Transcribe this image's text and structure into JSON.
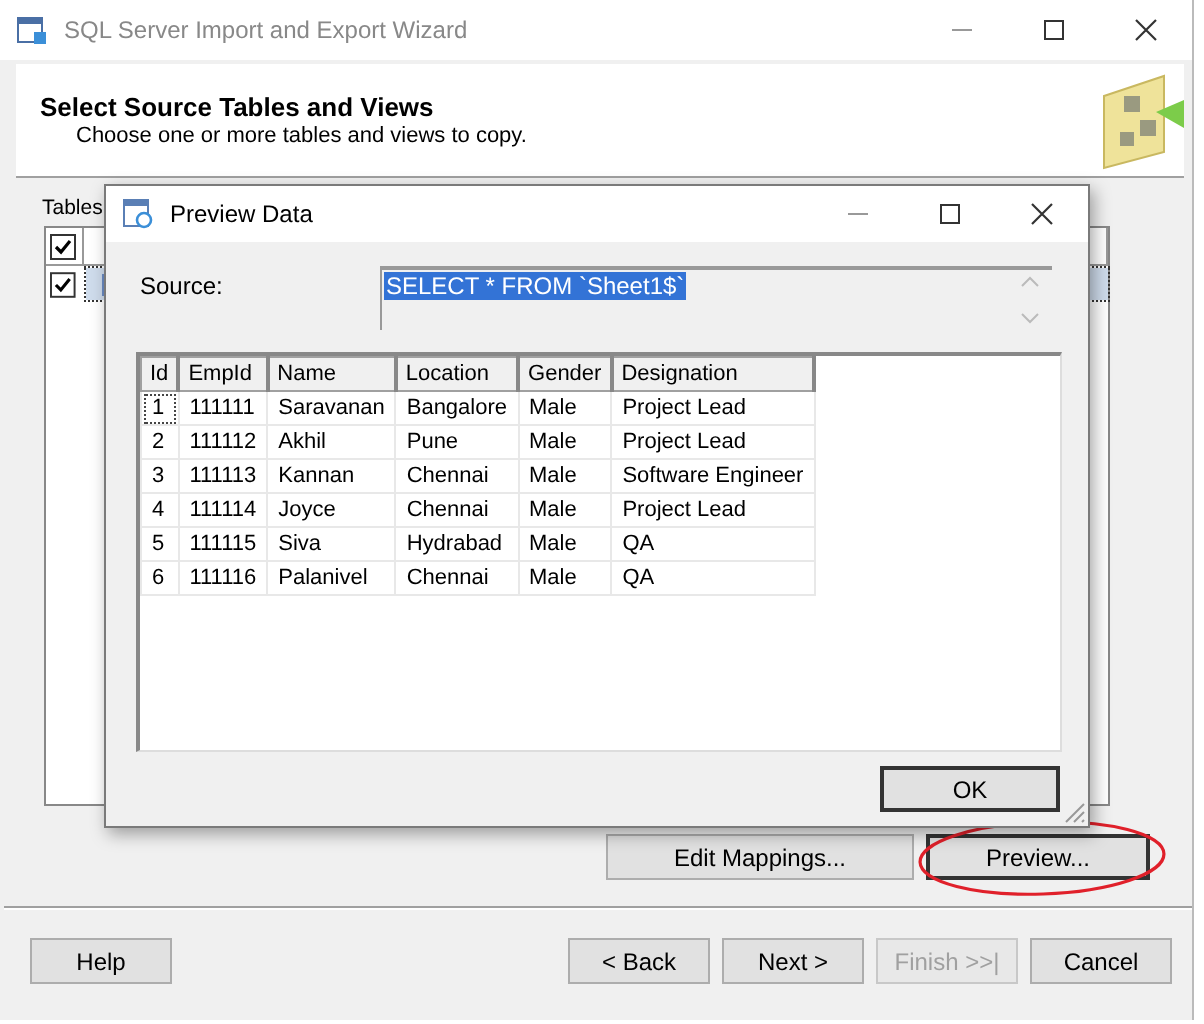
{
  "window": {
    "title": "SQL Server Import and Export Wizard"
  },
  "header": {
    "title": "Select Source Tables and Views",
    "subtitle": "Choose one or more tables and views to copy."
  },
  "tables_label": "Tables",
  "table_list": {
    "header": {
      "checked": true
    },
    "rows": [
      {
        "checked": true,
        "selected": true
      }
    ]
  },
  "preview_dialog": {
    "title": "Preview Data",
    "source_label": "Source:",
    "source_query": "SELECT * FROM `Sheet1$`",
    "query_selected": true,
    "columns": [
      "Id",
      "EmpId",
      "Name",
      "Location",
      "Gender",
      "Designation"
    ],
    "rows": [
      [
        "1",
        "111111",
        "Saravanan",
        "Bangalore",
        "Male",
        "Project Lead"
      ],
      [
        "2",
        "111112",
        "Akhil",
        "Pune",
        "Male",
        "Project Lead"
      ],
      [
        "3",
        "111113",
        "Kannan",
        "Chennai",
        "Male",
        "Software Engineer"
      ],
      [
        "4",
        "111114",
        "Joyce",
        "Chennai",
        "Male",
        "Project Lead"
      ],
      [
        "5",
        "111115",
        "Siva",
        "Hydrabad",
        "Male",
        "QA"
      ],
      [
        "6",
        "111116",
        "Palanivel",
        "Chennai",
        "Male",
        "QA"
      ]
    ],
    "ok": "OK"
  },
  "actions": [
    {
      "label": "Edit Mappings...",
      "highlighted": false
    },
    {
      "label": "Preview...",
      "highlighted": true
    }
  ],
  "footer_buttons": [
    {
      "label": "Help",
      "disabled": false
    },
    {
      "label": "< Back",
      "disabled": false
    },
    {
      "label": "Next >",
      "disabled": false
    },
    {
      "label": "Finish >>|",
      "disabled": true
    },
    {
      "label": "Cancel",
      "disabled": false
    }
  ]
}
